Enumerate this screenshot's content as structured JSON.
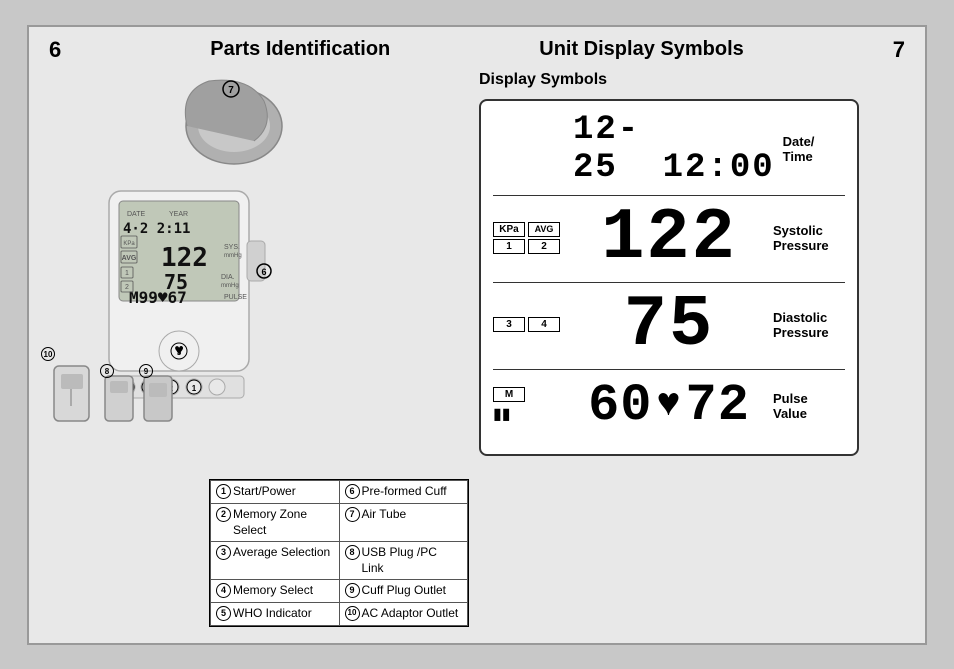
{
  "header": {
    "page_left": "6",
    "title_left": "Parts Identification",
    "title_right": "Unit Display Symbols",
    "page_right": "7"
  },
  "display_symbols": {
    "section_title": "Display Symbols",
    "rows": [
      {
        "id": "date-time",
        "icons": [],
        "value": "12-25  12:00",
        "label": "Date/\nTime",
        "lcd_class": "lcd-date"
      },
      {
        "id": "systolic",
        "icons": [
          "KPa",
          "AVG",
          "1",
          "2"
        ],
        "value": "122",
        "label": "Systolic\nPressure",
        "lcd_class": "lcd-large"
      },
      {
        "id": "diastolic",
        "icons": [
          "3",
          "4"
        ],
        "value": "75",
        "label": "Diastolic\nPressure",
        "lcd_class": "lcd-large"
      },
      {
        "id": "pulse",
        "icons": [
          "M"
        ],
        "value": "60♥72",
        "label": "Pulse\nValue",
        "lcd_class": "lcd-medium"
      }
    ]
  },
  "parts_list": [
    {
      "num": "1",
      "label": "Start/Power",
      "num2": "6",
      "label2": "Pre-formed Cuff"
    },
    {
      "num": "2",
      "label": "Memory Zone Select",
      "num2": "7",
      "label2": "Air Tube"
    },
    {
      "num": "3",
      "label": "Average Selection",
      "num2": "8",
      "label2": "USB Plug /PC Link"
    },
    {
      "num": "4",
      "label": "Memory Select",
      "num2": "9",
      "label2": "Cuff Plug Outlet"
    },
    {
      "num": "5",
      "label": "WHO Indicator",
      "num2": "10",
      "label2": "AC Adaptor Outlet"
    }
  ],
  "small_device_labels": [
    "8",
    "9",
    "10"
  ]
}
